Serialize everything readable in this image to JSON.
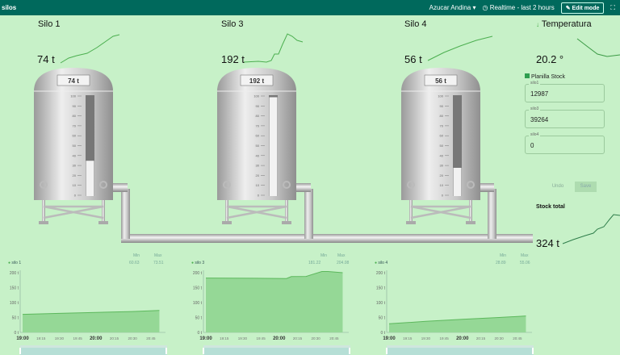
{
  "header": {
    "title": "silos",
    "org": "Azucar Andina",
    "time_range": "Realtime - last 2 hours",
    "edit_mode": "Edit mode"
  },
  "silos": [
    {
      "name": "Silo 1",
      "value": "74 t",
      "label": "74 t",
      "level_percent": 35
    },
    {
      "name": "Silo 3",
      "value": "192 t",
      "label": "192 t",
      "level_percent": 98
    },
    {
      "name": "Silo 4",
      "value": "56 t",
      "label": "56 t",
      "level_percent": 28
    }
  ],
  "gauge_scale": [
    "100",
    "90",
    "80",
    "70",
    "60",
    "50",
    "40",
    "30",
    "20",
    "10",
    "0"
  ],
  "temperature": {
    "title": "Temperatura",
    "value": "20.2 °"
  },
  "planilla": {
    "title": "Planilla Stock",
    "fields": [
      {
        "label": "silo1",
        "value": "12987"
      },
      {
        "label": "silo3",
        "value": "39264"
      },
      {
        "label": "silo4",
        "value": "0"
      }
    ],
    "undo": "Undo",
    "save": "Save"
  },
  "stock_total": {
    "title": "Stock total",
    "value": "324 t"
  },
  "colors": {
    "header": "#00695c",
    "fill": "#95d896",
    "line": "#5cb85c",
    "bg": "#c7f1c8"
  },
  "chart_data": [
    {
      "type": "area",
      "legend": "silo 1",
      "min_label": "Min",
      "max_label": "Max",
      "min": "60.63",
      "max": "73.51",
      "x": [
        0,
        30,
        60,
        90,
        112
      ],
      "values": [
        60.6,
        64,
        67,
        70,
        73.5
      ],
      "yticks": [
        "200 t",
        "150 t",
        "100 t",
        "50 t",
        "0 t"
      ],
      "ylim": [
        0,
        200
      ],
      "xticks": [
        "19:00",
        "19:15",
        "19:30",
        "19:45",
        "20:00",
        "20:15",
        "20:30",
        "20:45"
      ]
    },
    {
      "type": "area",
      "legend": "silo 3",
      "min_label": "Min",
      "max_label": "Max",
      "min": "181.22",
      "max": "204.08",
      "x": [
        0,
        40,
        66,
        70,
        82,
        95,
        100,
        112
      ],
      "values": [
        182,
        181.5,
        180.5,
        187,
        187.5,
        204,
        204,
        200
      ],
      "yticks": [
        "200 t",
        "150 t",
        "100 t",
        "50 t",
        "0 t"
      ],
      "ylim": [
        0,
        200
      ],
      "xticks": [
        "19:00",
        "19:15",
        "19:30",
        "19:45",
        "20:00",
        "20:15",
        "20:30",
        "20:45"
      ]
    },
    {
      "type": "area",
      "legend": "silo 4",
      "min_label": "Min",
      "max_label": "Max",
      "min": "28.89",
      "max": "55.06",
      "x": [
        0,
        30,
        60,
        90,
        112
      ],
      "values": [
        28.9,
        37,
        44,
        50,
        55
      ],
      "yticks": [
        "200 t",
        "150 t",
        "100 t",
        "50 t",
        "0 t"
      ],
      "ylim": [
        0,
        200
      ],
      "xticks": [
        "19:00",
        "19:15",
        "19:30",
        "19:45",
        "20:00",
        "20:15",
        "20:30",
        "20:45"
      ]
    }
  ]
}
